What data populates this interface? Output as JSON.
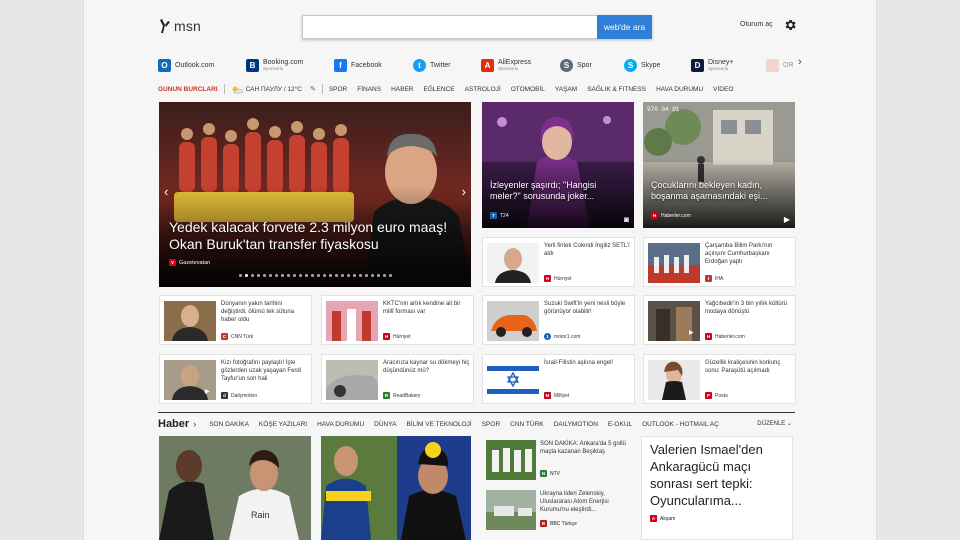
{
  "header": {
    "logo_text": "msn",
    "search_placeholder": "",
    "search_button": "web'de ara",
    "signin": "Oturum aç"
  },
  "shortcuts": [
    {
      "label": "Outlook.com",
      "sub": "",
      "icon": "outlook-icon",
      "color": "#0f6cbd",
      "glyph": "O"
    },
    {
      "label": "Booking.com",
      "sub": "Sponsorlu",
      "icon": "booking-icon",
      "color": "#003580",
      "glyph": "B"
    },
    {
      "label": "Facebook",
      "sub": "",
      "icon": "facebook-icon",
      "color": "#1877f2",
      "glyph": "f"
    },
    {
      "label": "Twitter",
      "sub": "",
      "icon": "twitter-icon",
      "color": "#1d9bf0",
      "glyph": "t"
    },
    {
      "label": "AliExpress",
      "sub": "Sponsorlu",
      "icon": "aliexpress-icon",
      "color": "#e62e04",
      "glyph": "A"
    },
    {
      "label": "Spor",
      "sub": "",
      "icon": "sports-icon",
      "color": "#5b6b7a",
      "glyph": "S"
    },
    {
      "label": "Skype",
      "sub": "",
      "icon": "skype-icon",
      "color": "#00aff0",
      "glyph": "S"
    },
    {
      "label": "Disney+",
      "sub": "Sponsorlu",
      "icon": "disney-icon",
      "color": "#0b1c3f",
      "glyph": "D"
    },
    {
      "label": "OR",
      "sub": "",
      "icon": "faded-icon",
      "color": "#f3b6a2",
      "glyph": ""
    }
  ],
  "nav": {
    "zodiac": "GUNUN BURCLARI",
    "weather": "САН ПАУЛУ / 12°C",
    "categories": [
      "SPOR",
      "FİNANS",
      "HABER",
      "EĞLENCE",
      "ASTROLOJİ",
      "OTOMOBİL",
      "YAŞAM",
      "SAĞLIK & FITNESS",
      "HAVA DURUMU",
      "VİDEO"
    ]
  },
  "hero": {
    "title": "Yedek kalacak forvete 2.3 milyon euro maaş! Okan Buruk'tan transfer fiyaskosu",
    "source": "Gazetevatan",
    "slides": 26,
    "active_slide": 1
  },
  "tiles": [
    {
      "title": "İzleyenler şaşırdı; \"Hangisi meler?\" sorusunda joker...",
      "source": "T24",
      "source_color": "#1b5fa8"
    },
    {
      "title": "Çocuklarını bekleyen kadın, boşanma aşamasındaki eşi...",
      "source": "Haberler.com",
      "source_color": "#d0021b",
      "stamp": "970 04 01"
    }
  ],
  "cards": [
    {
      "text": "Yerli fintek Colendi İngiliz SETL'i aldı",
      "source": "Hürriyet",
      "color": "#d0021b",
      "glyph": "H"
    },
    {
      "text": "Çarşamba Bilim Parkı'nın açılışını Cumhurbaşkanı Erdoğan yaptı",
      "source": "İHA",
      "color": "#c0392b",
      "glyph": "I"
    },
    {
      "text": "Dünyanın yakın tarihini değiştirdi, ölümü tek sütuna haber oldu",
      "source": "CNN Türk",
      "color": "#c0392b",
      "glyph": "C"
    },
    {
      "text": "KKTC'nin artık kendine ait bir millî forması var",
      "source": "Hürriyet",
      "color": "#d0021b",
      "glyph": "H"
    },
    {
      "text": "Suzuki Swift'in yeni nesli böyle görünüyor olabilir!",
      "source": "motor1.com",
      "color": "#1a5fb4",
      "glyph": "1"
    },
    {
      "text": "Yağcıbedir'in 3 bin yıllık kültürü modaya dönüştü",
      "source": "Haberler.com",
      "color": "#d0021b",
      "glyph": "H"
    },
    {
      "text": "Kızı fotoğrafını paylaştı! İşte gözlerden uzak yaşayan Ferdi Tayfur'un son hali",
      "source": "Dailymotion",
      "color": "#333333",
      "glyph": "d"
    },
    {
      "text": "Aracınıza kaynar su dökmeyi hiç düşündünüz mü?",
      "source": "ReadBakery",
      "color": "#2e7d32",
      "glyph": "R"
    },
    {
      "text": "İsrail-Filistin aşkına engel!",
      "source": "Milliyet",
      "color": "#d0021b",
      "glyph": "M"
    },
    {
      "text": "Güzellik kraliçesinin korkunç sonu: Paraşütü açılmadı",
      "source": "Posta",
      "color": "#d0021b",
      "glyph": "P"
    }
  ],
  "section": {
    "heading": "Haber",
    "links": [
      "SON DAKİKA",
      "KÖŞE YAZILARI",
      "HAVA DURUMU",
      "DÜNYA",
      "BİLİM VE TEKNOLOJİ",
      "SPOR",
      "CNN TÜRK",
      "DAILYMOTION",
      "E-OKUL",
      "OUTLOOK - HOTMAIL AÇ"
    ],
    "edit": "DÜZENLE"
  },
  "bottom_minis": [
    {
      "text": "SON DAKİKA: Ankara'da 5 gollü maçta kazanan Beşiktaş",
      "source": "NTV",
      "color": "#2e7d32",
      "glyph": "N"
    },
    {
      "text": "Ukrayna lideri Zelenskiy, Uluslararası Atom Enerjisi Kurumu'nu eleştirdi...",
      "source": "BBC Türkçe",
      "color": "#b71c1c",
      "glyph": "B"
    }
  ],
  "feature": {
    "title": "Valerien Ismael'den Ankaragücü maçı sonrası sert tepki: Oyuncularıma...",
    "source": "Akşam",
    "color": "#d0021b",
    "glyph": "A"
  }
}
